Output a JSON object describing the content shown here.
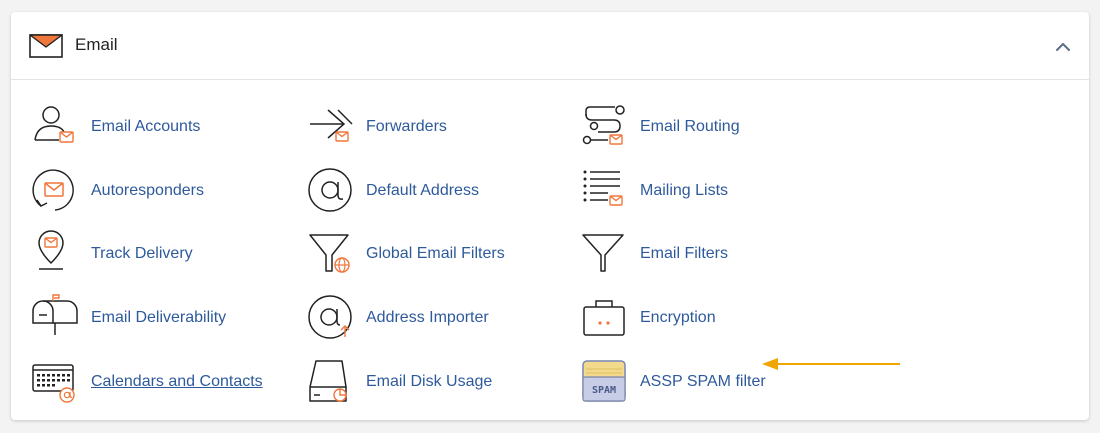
{
  "panel": {
    "title": "Email",
    "header_icon": "envelope-icon",
    "collapse_icon": "chevron-up-icon"
  },
  "tools": [
    {
      "label": "Email Accounts",
      "icon": "email-accounts-icon"
    },
    {
      "label": "Forwarders",
      "icon": "forwarders-icon"
    },
    {
      "label": "Email Routing",
      "icon": "email-routing-icon"
    },
    {
      "label": "Autoresponders",
      "icon": "autoresponders-icon"
    },
    {
      "label": "Default Address",
      "icon": "default-address-icon"
    },
    {
      "label": "Mailing Lists",
      "icon": "mailing-lists-icon"
    },
    {
      "label": "Track Delivery",
      "icon": "track-delivery-icon"
    },
    {
      "label": "Global Email Filters",
      "icon": "global-email-filters-icon"
    },
    {
      "label": "Email Filters",
      "icon": "email-filters-icon"
    },
    {
      "label": "Email Deliverability",
      "icon": "email-deliverability-icon"
    },
    {
      "label": "Address Importer",
      "icon": "address-importer-icon"
    },
    {
      "label": "Encryption",
      "icon": "encryption-icon"
    },
    {
      "label": "Calendars and Contacts",
      "icon": "calendars-contacts-icon"
    },
    {
      "label": "Email Disk Usage",
      "icon": "disk-usage-icon"
    },
    {
      "label": "ASSP SPAM filter",
      "icon": "spam-filter-icon",
      "badge": "SPAM"
    }
  ],
  "colors": {
    "link": "#2e5a9c",
    "accent_orange": "#f0773c",
    "annotation_arrow": "#f0a500"
  }
}
